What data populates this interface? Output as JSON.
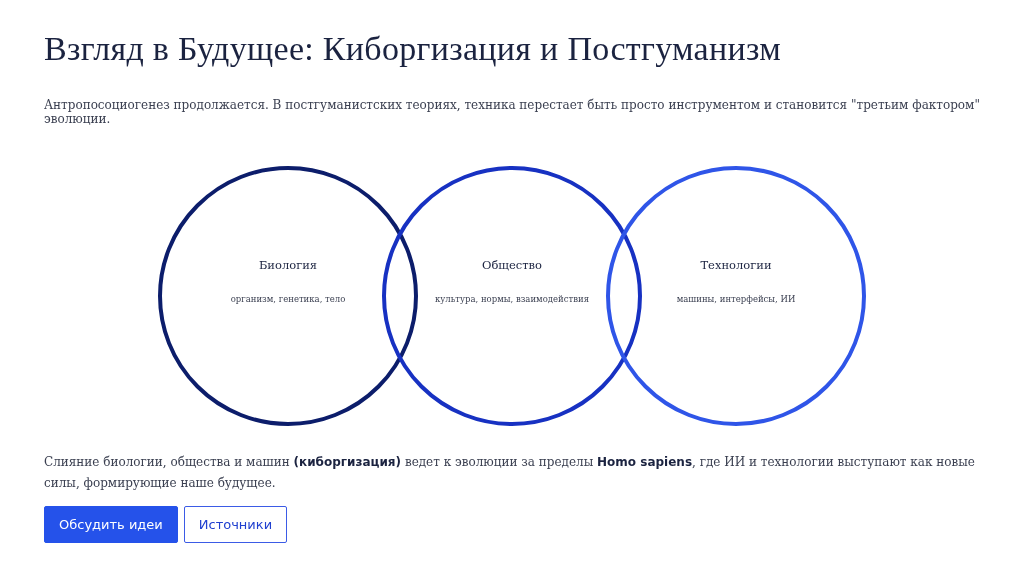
{
  "title": "Взгляд в Будущее: Киборгизация и Постгуманизм",
  "intro": "Антропосоциогенез продолжается. В постгуманистских теориях, техника перестает быть просто инструментом и становится \"третьим фактором\" эволюции.",
  "venn": [
    {
      "label": "Биология",
      "caption": "организм, генетика, тело",
      "color": "#0c1d6b"
    },
    {
      "label": "Общество",
      "caption": "культура, нормы, взаимодействия",
      "color": "#1731c2"
    },
    {
      "label": "Технологии",
      "caption": "машины, интерфейсы, ИИ",
      "color": "#2f55e8"
    }
  ],
  "summary": "Слияние биологии, общества и машин **(киборгизация)** ведет к эволюции за пределы **Homo sapiens**, где ИИ и технологии выступают как новые силы, формирующие наше будущее.",
  "buttons": [
    {
      "label": "Обсудить идеи",
      "kind": "primary"
    },
    {
      "label": "Источники",
      "kind": "secondary"
    }
  ]
}
